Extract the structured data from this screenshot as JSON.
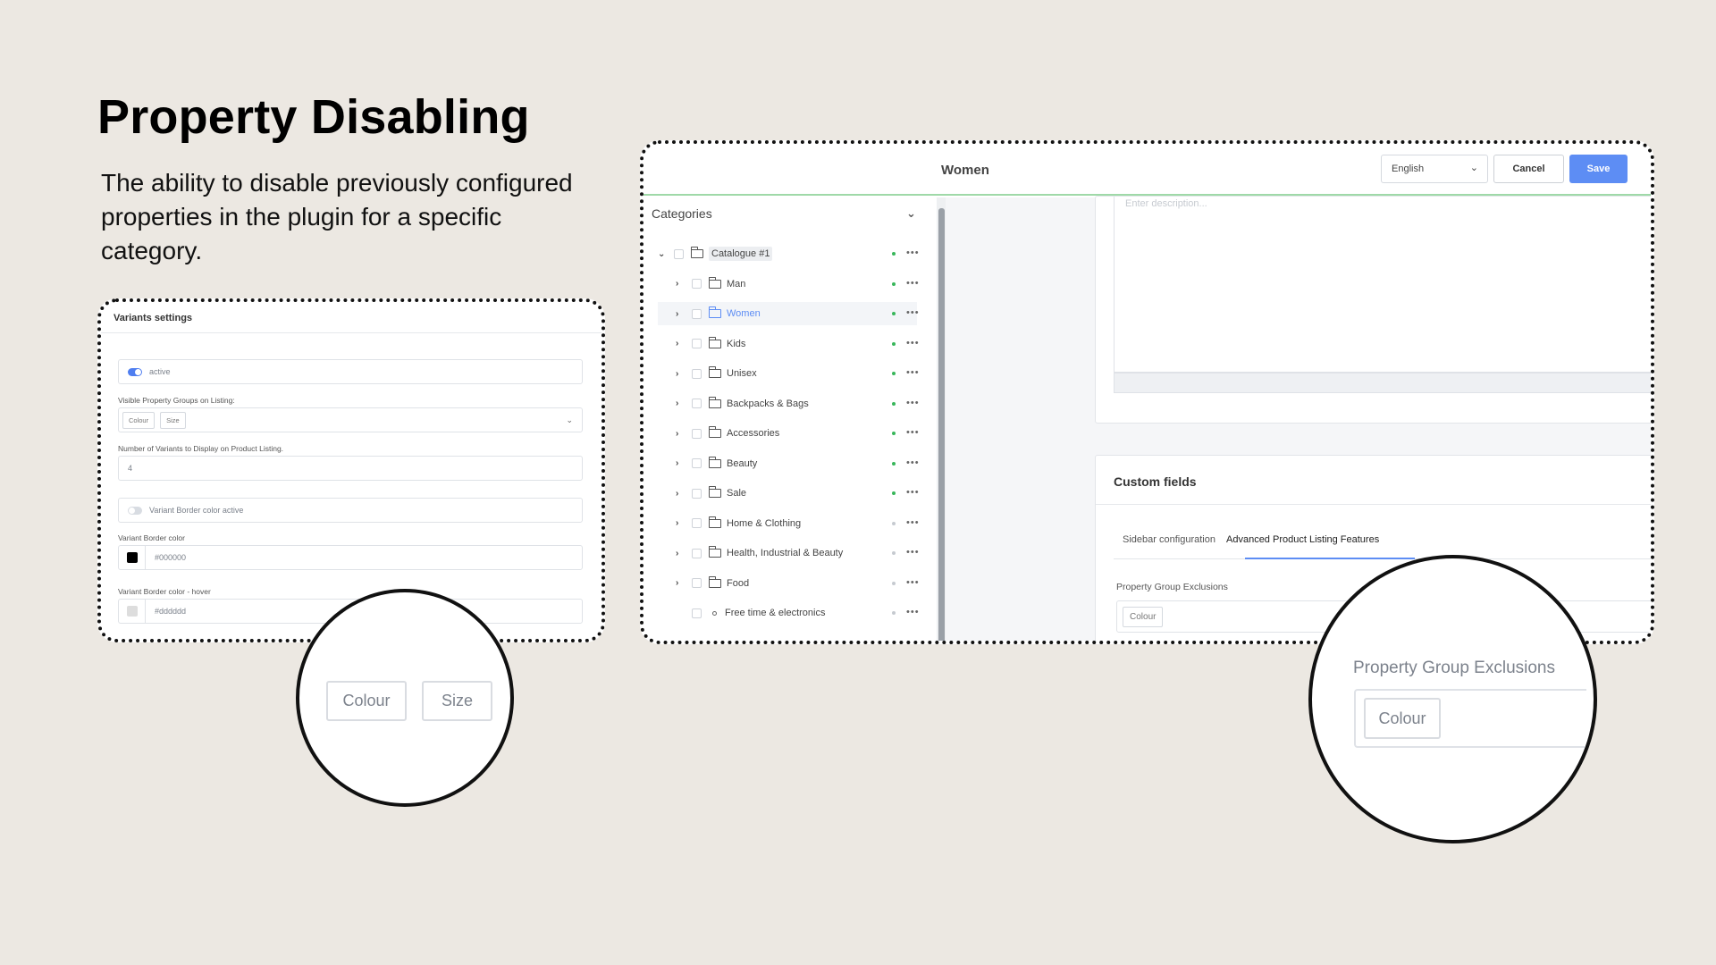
{
  "slide": {
    "title": "Property Disabling",
    "description": "The ability to disable previously configured properties in the plugin for a specific category."
  },
  "variants_settings": {
    "title": "Variants settings",
    "active_label": "active",
    "visible_groups_label": "Visible Property Groups on Listing:",
    "visible_groups": [
      "Colour",
      "Size"
    ],
    "num_variants_label": "Number of Variants to Display on Product Listing.",
    "num_variants_value": "4",
    "border_active_label": "Variant Border color active",
    "border_color_label": "Variant Border color",
    "border_color_value": "#000000",
    "border_hover_label": "Variant Border color - hover",
    "border_hover_value": "#dddddd"
  },
  "zoom_left": {
    "chips": [
      "Colour",
      "Size"
    ]
  },
  "zoom_right": {
    "label": "Property Group Exclusions",
    "chip": "Colour"
  },
  "admin": {
    "page_title": "Women",
    "language": "English",
    "cancel_label": "Cancel",
    "save_label": "Save",
    "categories_label": "Categories",
    "tree": [
      {
        "label": "Catalogue #1",
        "active": true
      },
      {
        "label": "Man",
        "active": true
      },
      {
        "label": "Women",
        "active": true,
        "selected": true
      },
      {
        "label": "Kids",
        "active": true
      },
      {
        "label": "Unisex",
        "active": true
      },
      {
        "label": "Backpacks & Bags",
        "active": true
      },
      {
        "label": "Accessories",
        "active": true
      },
      {
        "label": "Beauty",
        "active": true
      },
      {
        "label": "Sale",
        "active": true
      },
      {
        "label": "Home & Clothing",
        "active": false
      },
      {
        "label": "Health, Industrial & Beauty",
        "active": false
      },
      {
        "label": "Food",
        "active": false
      },
      {
        "label": "Free time & electronics",
        "active": false
      }
    ],
    "description_placeholder": "Enter description...",
    "custom_fields_title": "Custom fields",
    "tabs": [
      "Sidebar configuration",
      "Advanced Product Listing Features"
    ],
    "exclusions_label": "Property Group Exclusions",
    "exclusion_chip": "Colour"
  },
  "colors": {
    "accent": "#5d8df4",
    "status_active": "#38b65a",
    "background": "#ece8e2"
  },
  "icons": {
    "folder": "folder-icon",
    "chevron": "chevron-right-icon",
    "more": "more-horizontal-icon"
  }
}
